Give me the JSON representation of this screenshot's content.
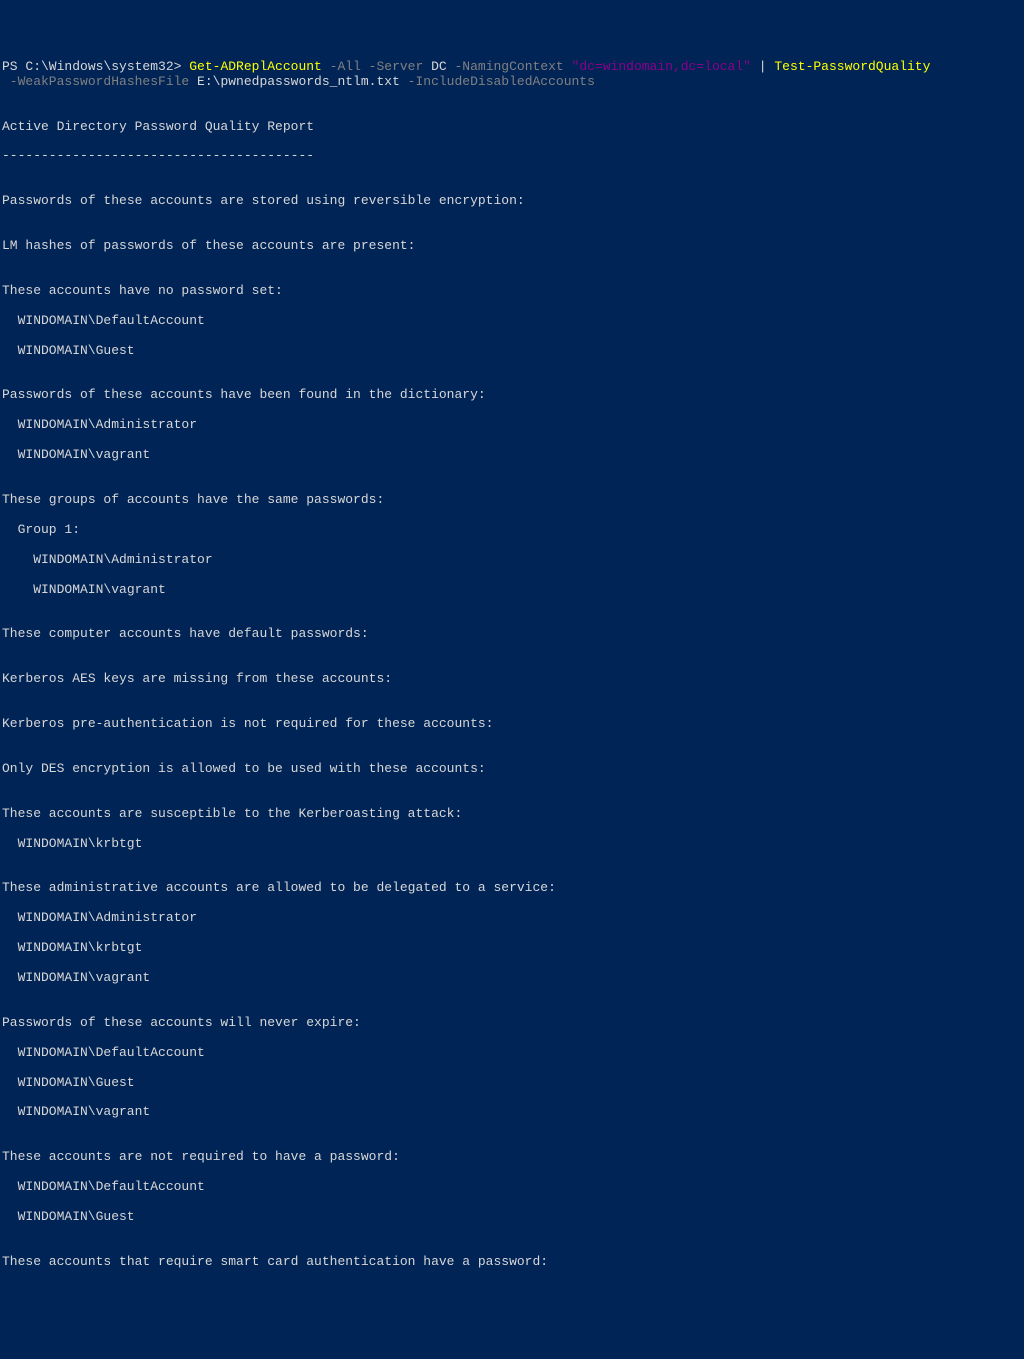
{
  "prompt": {
    "prefix": "PS C:\\Windows\\system32> ",
    "cmd1": "Get-ADReplAccount",
    "sw_all": " -All",
    "sw_server": " -Server",
    "arg_server": " DC",
    "sw_naming": " -NamingContext",
    "arg_naming": " \"dc=windomain,dc=local\"",
    "pipe": " | ",
    "cmd2": "Test-PasswordQuality",
    "sw_weak": " -WeakPasswordHashesFile",
    "arg_weak": " E:\\pwnedpasswords_ntlm.txt",
    "sw_include": " -IncludeDisabledAccounts"
  },
  "report": {
    "title": "Active Directory Password Quality Report",
    "underline": "----------------------------------------",
    "sections": {
      "reversible": {
        "header": "Passwords of these accounts are stored using reversible encryption:"
      },
      "lmhash": {
        "header": "LM hashes of passwords of these accounts are present:"
      },
      "nopassword": {
        "header": "These accounts have no password set:",
        "items": [
          "WINDOMAIN\\DefaultAccount",
          "WINDOMAIN\\Guest"
        ]
      },
      "dictionary": {
        "header": "Passwords of these accounts have been found in the dictionary:",
        "items": [
          "WINDOMAIN\\Administrator",
          "WINDOMAIN\\vagrant"
        ]
      },
      "samepass": {
        "header": "These groups of accounts have the same passwords:",
        "group_label": "Group 1:",
        "group_items": [
          "WINDOMAIN\\Administrator",
          "WINDOMAIN\\vagrant"
        ]
      },
      "compdefault": {
        "header": "These computer accounts have default passwords:"
      },
      "kerbmissing": {
        "header": "Kerberos AES keys are missing from these accounts:"
      },
      "preauth": {
        "header": "Kerberos pre-authentication is not required for these accounts:"
      },
      "desonly": {
        "header": "Only DES encryption is allowed to be used with these accounts:"
      },
      "kerberoasting": {
        "header": "These accounts are susceptible to the Kerberoasting attack:",
        "items": [
          "WINDOMAIN\\krbtgt"
        ]
      },
      "delegated": {
        "header": "These administrative accounts are allowed to be delegated to a service:",
        "items": [
          "WINDOMAIN\\Administrator",
          "WINDOMAIN\\krbtgt",
          "WINDOMAIN\\vagrant"
        ]
      },
      "neverexpire": {
        "header": "Passwords of these accounts will never expire:",
        "items": [
          "WINDOMAIN\\DefaultAccount",
          "WINDOMAIN\\Guest",
          "WINDOMAIN\\vagrant"
        ]
      },
      "notrequired": {
        "header": "These accounts are not required to have a password:",
        "items": [
          "WINDOMAIN\\DefaultAccount",
          "WINDOMAIN\\Guest"
        ]
      },
      "smartcard": {
        "header": "These accounts that require smart card authentication have a password:"
      }
    }
  }
}
